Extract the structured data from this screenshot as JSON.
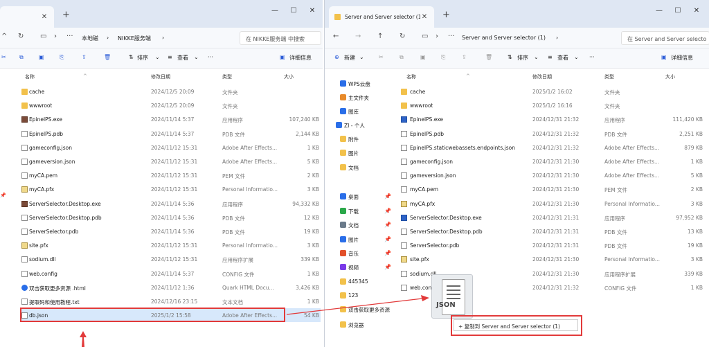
{
  "left": {
    "tab_title": "",
    "breadcrumb": [
      "本地磁",
      "NIKKE服务端"
    ],
    "search_placeholder": "在 NIKKE服务端 中搜索",
    "toolbar": {
      "sort": "排序",
      "view": "查看",
      "more": "···",
      "details": "详细信息"
    },
    "columns": {
      "name": "名称",
      "date": "修改日期",
      "type": "类型",
      "size": "大小"
    },
    "files": [
      {
        "name": "cache",
        "date": "2024/12/5 20:09",
        "type": "文件夹",
        "size": "",
        "icon": "folder-icon"
      },
      {
        "name": "wwwroot",
        "date": "2024/12/5 20:09",
        "type": "文件夹",
        "size": "",
        "icon": "folder-icon"
      },
      {
        "name": "EpinelPS.exe",
        "date": "2024/11/14 5:37",
        "type": "应用程序",
        "size": "107,240 KB",
        "icon": "exe-icon"
      },
      {
        "name": "EpinelPS.pdb",
        "date": "2024/11/14 5:37",
        "type": "PDB 文件",
        "size": "2,144 KB",
        "icon": "file-icon"
      },
      {
        "name": "gameconfig.json",
        "date": "2024/11/12 15:31",
        "type": "Adobe After Effects...",
        "size": "1 KB",
        "icon": "json-icon"
      },
      {
        "name": "gameversion.json",
        "date": "2024/11/12 15:31",
        "type": "Adobe After Effects...",
        "size": "5 KB",
        "icon": "json-icon"
      },
      {
        "name": "myCA.pem",
        "date": "2024/11/12 15:31",
        "type": "PEM 文件",
        "size": "2 KB",
        "icon": "file-icon"
      },
      {
        "name": "myCA.pfx",
        "date": "2024/11/12 15:31",
        "type": "Personal Informatio...",
        "size": "3 KB",
        "icon": "cert-icon"
      },
      {
        "name": "ServerSelector.Desktop.exe",
        "date": "2024/11/14 5:36",
        "type": "应用程序",
        "size": "94,332 KB",
        "icon": "exe-icon"
      },
      {
        "name": "ServerSelector.Desktop.pdb",
        "date": "2024/11/14 5:36",
        "type": "PDB 文件",
        "size": "12 KB",
        "icon": "file-icon"
      },
      {
        "name": "ServerSelector.pdb",
        "date": "2024/11/14 5:36",
        "type": "PDB 文件",
        "size": "19 KB",
        "icon": "file-icon"
      },
      {
        "name": "site.pfx",
        "date": "2024/11/12 15:31",
        "type": "Personal Informatio...",
        "size": "3 KB",
        "icon": "cert-icon"
      },
      {
        "name": "sodium.dll",
        "date": "2024/11/12 15:31",
        "type": "应用程序扩展",
        "size": "339 KB",
        "icon": "dll-icon"
      },
      {
        "name": "web.config",
        "date": "2024/11/14 5:37",
        "type": "CONFIG 文件",
        "size": "1 KB",
        "icon": "file-icon"
      },
      {
        "name": "双击获取更多资源 .html",
        "date": "2024/11/12 1:36",
        "type": "Quark HTML Docu...",
        "size": "3,426 KB",
        "icon": "html-icon"
      },
      {
        "name": "提取码和使用教程.txt",
        "date": "2024/12/16 23:15",
        "type": "文本文档",
        "size": "1 KB",
        "icon": "txt-icon"
      },
      {
        "name": "db.json",
        "date": "2025/1/2 15:58",
        "type": "Adobe After Effects...",
        "size": "54 KB",
        "icon": "json-icon",
        "selected": true
      }
    ]
  },
  "right": {
    "tab_title": "Server and Server selector (1)",
    "breadcrumb": [
      "Server and Server selector (1)"
    ],
    "search_placeholder": "在 Server and Server selecto",
    "toolbar": {
      "new": "新建",
      "sort": "排序",
      "view": "查看",
      "more": "···",
      "details": "详细信息"
    },
    "columns": {
      "name": "名称",
      "date": "修改日期",
      "type": "类型",
      "size": "大小"
    },
    "sidebar": [
      {
        "label": "WPS云盘",
        "icon": "cloud-icon"
      },
      {
        "label": "主文件夹",
        "icon": "home-icon"
      },
      {
        "label": "图库",
        "icon": "gallery-icon"
      },
      {
        "label": "ZI - 个人",
        "icon": "cloud-icon"
      },
      {
        "label": "附件",
        "icon": "folder-icon"
      },
      {
        "label": "图片",
        "icon": "folder-icon"
      },
      {
        "label": "文档",
        "icon": "folder-icon"
      },
      {
        "label": "桌面",
        "icon": "desktop-icon"
      },
      {
        "label": "下载",
        "icon": "download-icon"
      },
      {
        "label": "文档",
        "icon": "document-icon"
      },
      {
        "label": "图片",
        "icon": "picture-icon"
      },
      {
        "label": "音乐",
        "icon": "music-icon"
      },
      {
        "label": "视频",
        "icon": "video-icon"
      },
      {
        "label": "445345",
        "icon": "folder-icon"
      },
      {
        "label": "123",
        "icon": "folder-icon"
      },
      {
        "label": "双击获取更多资源",
        "icon": "folder-icon"
      },
      {
        "label": "浏览器",
        "icon": "folder-icon"
      }
    ],
    "files": [
      {
        "name": "cache",
        "date": "2025/1/2 16:02",
        "type": "文件夹",
        "size": "",
        "icon": "folder-icon"
      },
      {
        "name": "wwwroot",
        "date": "2025/1/2 16:16",
        "type": "文件夹",
        "size": "",
        "icon": "folder-icon"
      },
      {
        "name": "EpinelPS.exe",
        "date": "2024/12/31 21:32",
        "type": "应用程序",
        "size": "111,420 KB",
        "icon": "blue-exe-icon"
      },
      {
        "name": "EpinelPS.pdb",
        "date": "2024/12/31 21:32",
        "type": "PDB 文件",
        "size": "2,251 KB",
        "icon": "file-icon"
      },
      {
        "name": "EpinelPS.staticwebassets.endpoints.json",
        "date": "2024/12/31 21:32",
        "type": "Adobe After Effects...",
        "size": "879 KB",
        "icon": "json-icon"
      },
      {
        "name": "gameconfig.json",
        "date": "2024/12/31 21:30",
        "type": "Adobe After Effects...",
        "size": "1 KB",
        "icon": "json-icon"
      },
      {
        "name": "gameversion.json",
        "date": "2024/12/31 21:30",
        "type": "Adobe After Effects...",
        "size": "5 KB",
        "icon": "json-icon"
      },
      {
        "name": "myCA.pem",
        "date": "2024/12/31 21:30",
        "type": "PEM 文件",
        "size": "2 KB",
        "icon": "file-icon"
      },
      {
        "name": "myCA.pfx",
        "date": "2024/12/31 21:30",
        "type": "Personal Informatio...",
        "size": "3 KB",
        "icon": "cert-icon"
      },
      {
        "name": "ServerSelector.Desktop.exe",
        "date": "2024/12/31 21:31",
        "type": "应用程序",
        "size": "97,952 KB",
        "icon": "blue-exe-icon"
      },
      {
        "name": "ServerSelector.Desktop.pdb",
        "date": "2024/12/31 21:31",
        "type": "PDB 文件",
        "size": "13 KB",
        "icon": "file-icon"
      },
      {
        "name": "ServerSelector.pdb",
        "date": "2024/12/31 21:31",
        "type": "PDB 文件",
        "size": "19 KB",
        "icon": "file-icon"
      },
      {
        "name": "site.pfx",
        "date": "2024/12/31 21:30",
        "type": "Personal Informatio...",
        "size": "3 KB",
        "icon": "cert-icon"
      },
      {
        "name": "sodium.dll",
        "date": "2024/12/31 21:30",
        "type": "应用程序扩展",
        "size": "339 KB",
        "icon": "dll-icon"
      },
      {
        "name": "web.config",
        "date": "2024/12/31 21:32",
        "type": "CONFIG 文件",
        "size": "1 KB",
        "icon": "file-icon"
      }
    ],
    "drag_label": "JSON",
    "drop_tooltip": "+ 复制到 Server and Server selector (1)"
  }
}
